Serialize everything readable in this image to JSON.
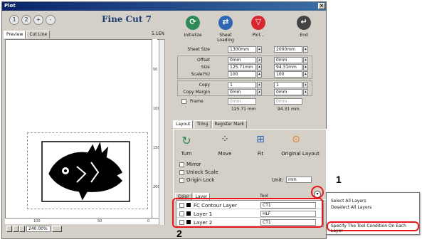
{
  "window": {
    "title": "Plot",
    "close_glyph": "×"
  },
  "toolbar": {
    "zoom_buttons": [
      "1",
      "2",
      "+",
      "-"
    ],
    "logo": "Fine Cut 7",
    "actions": [
      {
        "label": "Initialize",
        "icon": "refresh-icon",
        "color": "#2e8b57"
      },
      {
        "label": "Sheet Loading",
        "icon": "sheet-loading-icon",
        "color": "#2e66b4"
      },
      {
        "label": "Plot...",
        "icon": "plot-icon",
        "color": "#d7262e"
      },
      {
        "label": "End",
        "icon": "end-icon",
        "color": "#444444"
      }
    ]
  },
  "view_tabs": [
    "Preview",
    "Cut Line"
  ],
  "version": "5.1EN",
  "preview": {
    "ruler_bottom": [
      "100",
      "50",
      "0"
    ],
    "ruler_right": [
      "50",
      "100",
      "150",
      "200"
    ],
    "zoom": "240.00%"
  },
  "params": {
    "sheet_size": {
      "label": "Sheet Size",
      "w": "1300mm",
      "h": "2000mm"
    },
    "offset": {
      "label": "Offset",
      "w": "0mm",
      "h": "0mm"
    },
    "size": {
      "label": "Size",
      "w": "125.71mm",
      "h": "94.31mm"
    },
    "scale": {
      "label": "Scale(%)",
      "w": "100",
      "h": "100"
    },
    "copy": {
      "label": "Copy",
      "w": "1",
      "h": "1"
    },
    "copy_margin": {
      "label": "Copy Margin",
      "w": "0mm",
      "h": "0mm"
    },
    "frame": {
      "label": "Frame",
      "w": "0mm",
      "h": "0mm"
    },
    "total": {
      "w": "125.71 mm",
      "h": "94.31 mm"
    }
  },
  "layout_tabs": [
    "Layout",
    "Tiling",
    "Register Mark"
  ],
  "layout_tools": [
    {
      "label": "Turn",
      "icon": "turn-icon"
    },
    {
      "label": "Move",
      "icon": "move-icon"
    },
    {
      "label": "Fit",
      "icon": "fit-icon"
    },
    {
      "label": "Original Layout",
      "icon": "original-layout-icon"
    }
  ],
  "options": {
    "mirror": "Mirror",
    "unlock_scale": "Unlock Scale",
    "origin_lock": "Origin Lock",
    "unit_label": "Unit:",
    "unit_value": "mm"
  },
  "layer_tabs": [
    "Color",
    "Layer"
  ],
  "layer_header_tool": "Tool",
  "layers": [
    {
      "name": "FC Contour Layer",
      "tool": "CT1"
    },
    {
      "name": "Layer 1",
      "tool": "HLF"
    },
    {
      "name": "Layer 2",
      "tool": "CT1"
    }
  ],
  "context_menu": {
    "items": [
      "Select All Layers",
      "Deselect All Layers"
    ],
    "highlight": "Specify The Tool Condition On Each Layer"
  },
  "annotations": {
    "one": "1",
    "two": "2"
  },
  "colors": {
    "accent_red": "#e8151b"
  }
}
